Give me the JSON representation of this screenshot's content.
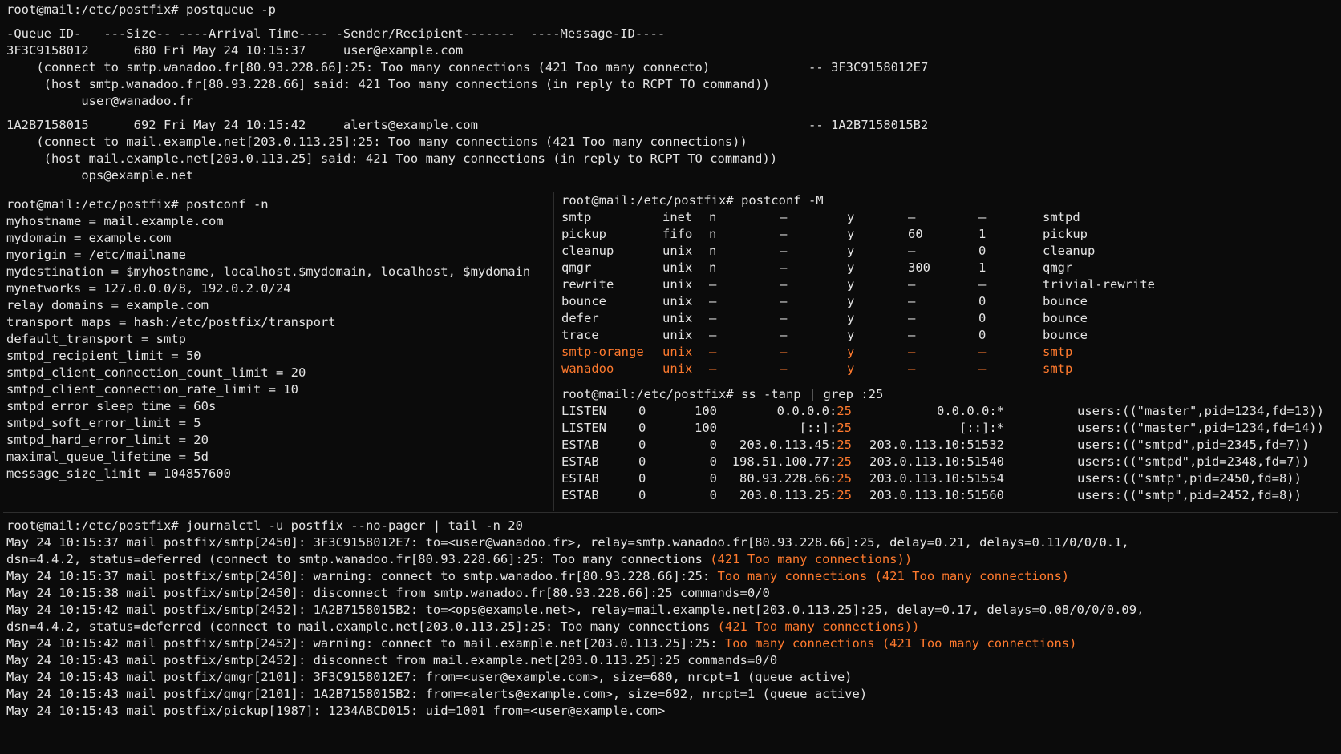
{
  "terminal": {
    "prompt": "root@mail:/etc/postfix#",
    "accent_color": "#ff7a2e",
    "background": "#0b0b0b",
    "foreground": "#e4e4e4"
  },
  "postqueue": {
    "command": "postqueue -p",
    "header": "-Queue ID-   ---Size-- ----Arrival Time---- -Sender/Recipient-------  ----Message-ID----",
    "entries": [
      {
        "line": "3F3C9158012      680 Fri May 24 10:15:37     user@example.com",
        "reason": "    (connect to smtp.wanadoo.fr[80.93.228.66]:25: Too many connections (421 Too many connecto)",
        "message_id": "-- 3F3C9158012E7",
        "host_said": "     (host smtp.wanadoo.fr[80.93.228.66] said: 421 Too many connections (in reply to RCPT TO command))",
        "recipient": "          user@wanadoo.fr"
      },
      {
        "line": "1A2B7158015      692 Fri May 24 10:15:42     alerts@example.com",
        "reason": "    (connect to mail.example.net[203.0.113.25]:25: Too many connections (421 Too many connections))",
        "message_id": "-- 1A2B7158015B2",
        "host_said": "     (host mail.example.net[203.0.113.25] said: 421 Too many connections (in reply to RCPT TO command))",
        "recipient": "          ops@example.net"
      }
    ]
  },
  "postconf_n": {
    "command": "postconf -n",
    "lines": [
      "myhostname = mail.example.com",
      "mydomain = example.com",
      "myorigin = /etc/mailname",
      "mydestination = $myhostname, localhost.$mydomain, localhost, $mydomain",
      "mynetworks = 127.0.0.0/8, 192.0.2.0/24",
      "relay_domains = example.com",
      "transport_maps = hash:/etc/postfix/transport",
      "default_transport = smtp",
      "smtpd_recipient_limit = 50",
      "smtpd_client_connection_count_limit = 20",
      "smtpd_client_connection_rate_limit = 10",
      "smtpd_error_sleep_time = 60s",
      "smtpd_soft_error_limit = 5",
      "smtpd_hard_error_limit = 20",
      "maximal_queue_lifetime = 5d",
      "message_size_limit = 104857600"
    ]
  },
  "postconf_M": {
    "command": "postconf -M",
    "rows": [
      {
        "service": "smtp",
        "type": "inet",
        "private": "n",
        "unpriv": "–",
        "chroot": "y",
        "wakeup": "–",
        "maxproc": "–",
        "command": "smtpd",
        "highlight": false
      },
      {
        "service": "pickup",
        "type": "fifo",
        "private": "n",
        "unpriv": "–",
        "chroot": "y",
        "wakeup": "60",
        "maxproc": "1",
        "command": "pickup",
        "highlight": false
      },
      {
        "service": "cleanup",
        "type": "unix",
        "private": "n",
        "unpriv": "–",
        "chroot": "y",
        "wakeup": "–",
        "maxproc": "0",
        "command": "cleanup",
        "highlight": false
      },
      {
        "service": "qmgr",
        "type": "unix",
        "private": "n",
        "unpriv": "–",
        "chroot": "y",
        "wakeup": "300",
        "maxproc": "1",
        "command": "qmgr",
        "highlight": false
      },
      {
        "service": "rewrite",
        "type": "unix",
        "private": "–",
        "unpriv": "–",
        "chroot": "y",
        "wakeup": "–",
        "maxproc": "–",
        "command": "trivial-rewrite",
        "highlight": false
      },
      {
        "service": "bounce",
        "type": "unix",
        "private": "–",
        "unpriv": "–",
        "chroot": "y",
        "wakeup": "–",
        "maxproc": "0",
        "command": "bounce",
        "highlight": false
      },
      {
        "service": "defer",
        "type": "unix",
        "private": "–",
        "unpriv": "–",
        "chroot": "y",
        "wakeup": "–",
        "maxproc": "0",
        "command": "bounce",
        "highlight": false
      },
      {
        "service": "trace",
        "type": "unix",
        "private": "–",
        "unpriv": "–",
        "chroot": "y",
        "wakeup": "–",
        "maxproc": "0",
        "command": "bounce",
        "highlight": false
      },
      {
        "service": "smtp-orange",
        "type": "unix",
        "private": "–",
        "unpriv": "–",
        "chroot": "y",
        "wakeup": "–",
        "maxproc": "–",
        "command": "smtp",
        "highlight": true
      },
      {
        "service": "wanadoo",
        "type": "unix",
        "private": "–",
        "unpriv": "–",
        "chroot": "y",
        "wakeup": "–",
        "maxproc": "–",
        "command": "smtp",
        "highlight": true
      }
    ]
  },
  "ss": {
    "command": "ss -tanp | grep :25",
    "rows": [
      {
        "state": "LISTEN",
        "recvq": "0",
        "sendq": "100",
        "local": "0.0.0.0:",
        "lport": "25",
        "peer": "0.0.0.0:*",
        "process": "users:((\"master\",pid=1234,fd=13))"
      },
      {
        "state": "LISTEN",
        "recvq": "0",
        "sendq": "100",
        "local": "[::]:",
        "lport": "25",
        "peer": "[::]:*",
        "process": "users:((\"master\",pid=1234,fd=14))"
      },
      {
        "state": "ESTAB",
        "recvq": "0",
        "sendq": "0",
        "local": "203.0.113.45:",
        "lport": "25",
        "peer": "203.0.113.10:51532",
        "process": "users:((\"smtpd\",pid=2345,fd=7))"
      },
      {
        "state": "ESTAB",
        "recvq": "0",
        "sendq": "0",
        "local": "198.51.100.77:",
        "lport": "25",
        "peer": "203.0.113.10:51540",
        "process": "users:((\"smtpd\",pid=2348,fd=7))"
      },
      {
        "state": "ESTAB",
        "recvq": "0",
        "sendq": "0",
        "local": "80.93.228.66:",
        "lport": "25",
        "peer": "203.0.113.10:51554",
        "process": "users:((\"smtp\",pid=2450,fd=8))"
      },
      {
        "state": "ESTAB",
        "recvq": "0",
        "sendq": "0",
        "local": "203.0.113.25:",
        "lport": "25",
        "peer": "203.0.113.10:51560",
        "process": "users:((\"smtp\",pid=2452,fd=8))"
      }
    ]
  },
  "journal": {
    "command": "journalctl -u postfix --no-pager | tail -n 20",
    "lines": [
      {
        "text": "May 24 10:15:37 mail postfix/smtp[2450]: 3F3C9158012E7: to=<user@wanadoo.fr>, relay=smtp.wanadoo.fr[80.93.228.66]:25, delay=0.21, delays=0.11/0/0/0.1,",
        "hl": ""
      },
      {
        "text": "dsn=4.4.2, status=deferred (connect to smtp.wanadoo.fr[80.93.228.66]:25: Too many connections ",
        "hl": "(421 Too many connections))"
      },
      {
        "text": "May 24 10:15:37 mail postfix/smtp[2450]: warning: connect to smtp.wanadoo.fr[80.93.228.66]:25: ",
        "hl": "Too many connections (421 Too many connections)"
      },
      {
        "text": "May 24 10:15:38 mail postfix/smtp[2450]: disconnect from smtp.wanadoo.fr[80.93.228.66]:25 commands=0/0",
        "hl": ""
      },
      {
        "text": "May 24 10:15:42 mail postfix/smtp[2452]: 1A2B7158015B2: to=<ops@example.net>, relay=mail.example.net[203.0.113.25]:25, delay=0.17, delays=0.08/0/0/0.09,",
        "hl": ""
      },
      {
        "text": "dsn=4.4.2, status=deferred (connect to mail.example.net[203.0.113.25]:25: Too many connections ",
        "hl": "(421 Too many connections))"
      },
      {
        "text": "May 24 10:15:42 mail postfix/smtp[2452]: warning: connect to mail.example.net[203.0.113.25]:25: ",
        "hl": "Too many connections (421 Too many connections)"
      },
      {
        "text": "May 24 10:15:43 mail postfix/smtp[2452]: disconnect from mail.example.net[203.0.113.25]:25 commands=0/0",
        "hl": ""
      },
      {
        "text": "May 24 10:15:43 mail postfix/qmgr[2101]: 3F3C9158012E7: from=<user@example.com>, size=680, nrcpt=1 (queue active)",
        "hl": ""
      },
      {
        "text": "May 24 10:15:43 mail postfix/qmgr[2101]: 1A2B7158015B2: from=<alerts@example.com>, size=692, nrcpt=1 (queue active)",
        "hl": ""
      },
      {
        "text": "May 24 10:15:43 mail postfix/pickup[1987]: 1234ABCD015: uid=1001 from=<user@example.com>",
        "hl": ""
      }
    ]
  }
}
